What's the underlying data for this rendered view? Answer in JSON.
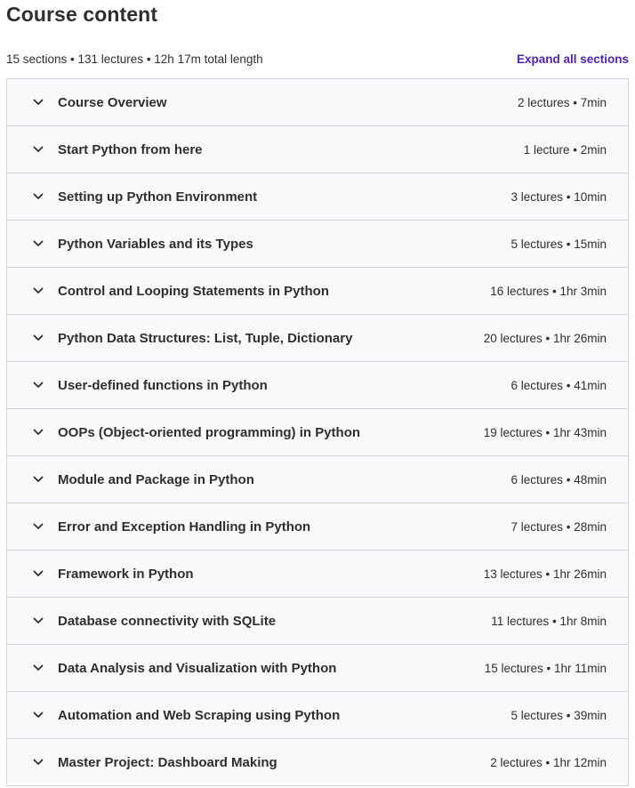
{
  "header": {
    "title": "Course content",
    "summary": "15 sections • 131 lectures • 12h 17m total length",
    "expand_label": "Expand all sections"
  },
  "colors": {
    "accent": "#5022c3",
    "section_bg": "#f7f9fa",
    "border": "#d1d7dc",
    "text": "#2d2f31"
  },
  "icons": {
    "section_toggle": "chevron-down-icon"
  },
  "sections": [
    {
      "title": "Course Overview",
      "meta": "2 lectures • 7min"
    },
    {
      "title": "Start Python from here",
      "meta": "1 lecture • 2min"
    },
    {
      "title": "Setting up Python Environment",
      "meta": "3 lectures • 10min"
    },
    {
      "title": "Python Variables and its Types",
      "meta": "5 lectures • 15min"
    },
    {
      "title": "Control and Looping Statements in Python",
      "meta": "16 lectures • 1hr 3min"
    },
    {
      "title": "Python Data Structures: List, Tuple, Dictionary",
      "meta": "20 lectures • 1hr 26min"
    },
    {
      "title": "User-defined functions in Python",
      "meta": "6 lectures • 41min"
    },
    {
      "title": "OOPs (Object-oriented programming) in Python",
      "meta": "19 lectures • 1hr 43min"
    },
    {
      "title": "Module and Package in Python",
      "meta": "6 lectures • 48min"
    },
    {
      "title": "Error and Exception Handling in Python",
      "meta": "7 lectures • 28min"
    },
    {
      "title": "Framework in Python",
      "meta": "13 lectures • 1hr 26min"
    },
    {
      "title": "Database connectivity with SQLite",
      "meta": "11 lectures • 1hr 8min"
    },
    {
      "title": "Data Analysis and Visualization with Python",
      "meta": "15 lectures • 1hr 11min"
    },
    {
      "title": "Automation and Web Scraping using Python",
      "meta": "5 lectures • 39min"
    },
    {
      "title": "Master Project: Dashboard Making",
      "meta": "2 lectures • 1hr 12min"
    }
  ]
}
